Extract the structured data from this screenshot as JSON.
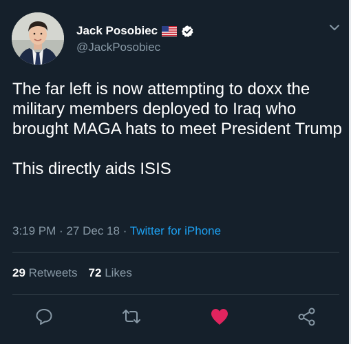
{
  "author": {
    "display_name": "Jack Posobiec",
    "handle": "@JackPosobiec",
    "flag_icon": "us-flag-icon",
    "verified_icon": "verified-badge-icon"
  },
  "tweet": {
    "paragraph_1": "The far left is now attempting to doxx the military members deployed to Iraq who brought MAGA hats to meet President Trump",
    "paragraph_2": "This directly aids ISIS",
    "time": "3:19 PM",
    "separator": "·",
    "date": "27 Dec 18",
    "source": "Twitter for iPhone"
  },
  "stats": {
    "retweets_count": "29",
    "retweets_label": "Retweets",
    "likes_count": "72",
    "likes_label": "Likes"
  },
  "actions": {
    "reply_icon": "reply-icon",
    "retweet_icon": "retweet-icon",
    "like_icon": "heart-icon",
    "share_icon": "share-icon",
    "like_color": "#e0245e"
  },
  "colors": {
    "background": "#15202b",
    "secondary_text": "#8899a6",
    "link": "#1da1f2",
    "divider": "#38444d"
  }
}
